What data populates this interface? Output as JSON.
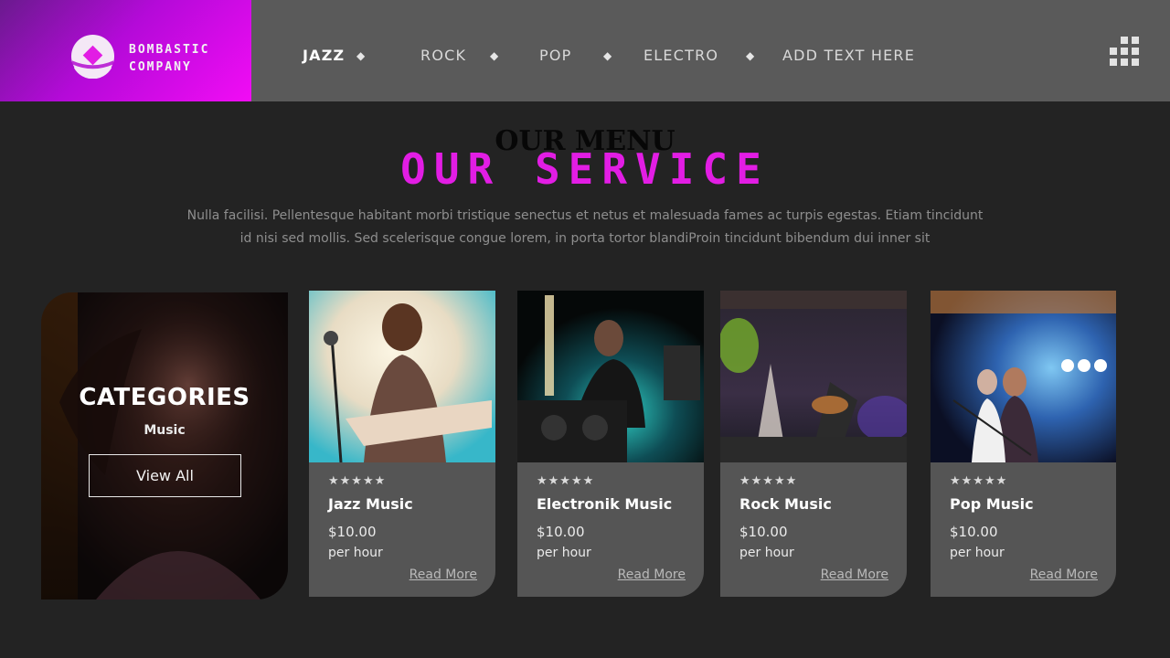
{
  "brand": {
    "line1": "BOMBASTIC",
    "line2": "COMPANY"
  },
  "nav": {
    "items": [
      {
        "label": "JAZZ"
      },
      {
        "label": "ROCK"
      },
      {
        "label": "POP"
      },
      {
        "label": "ELECTRO"
      },
      {
        "label": "ADD TEXT HERE"
      }
    ]
  },
  "hero": {
    "overline": "OUR MENU",
    "title": "OUR SERVICE",
    "description_line1": "Nulla facilisi. Pellentesque habitant morbi tristique senectus et netus et malesuada fames ac turpis egestas. Etiam tincidunt",
    "description_line2": "id nisi sed mollis. Sed scelerisque congue lorem, in porta tortor blandiProin tincidunt bibendum dui inner sit"
  },
  "categories": {
    "title": "CATEGORIES",
    "subtitle": "Music",
    "button": "View All"
  },
  "cards": [
    {
      "stars": "★★★★★",
      "name": "Jazz Music",
      "price": "$10.00",
      "unit": "per hour",
      "link": "Read More"
    },
    {
      "stars": "★★★★★",
      "name": "Electronik Music",
      "price": "$10.00",
      "unit": "per hour",
      "link": "Read More"
    },
    {
      "stars": "★★★★★",
      "name": "Rock Music",
      "price": "$10.00",
      "unit": "per hour",
      "link": "Read More"
    },
    {
      "stars": "★★★★★",
      "name": "Pop Music",
      "price": "$10.00",
      "unit": "per hour",
      "link": "Read More"
    }
  ],
  "colors": {
    "accent": "#e21de4",
    "header": "#5a5a5a",
    "background": "#232323",
    "card": "#555555"
  }
}
